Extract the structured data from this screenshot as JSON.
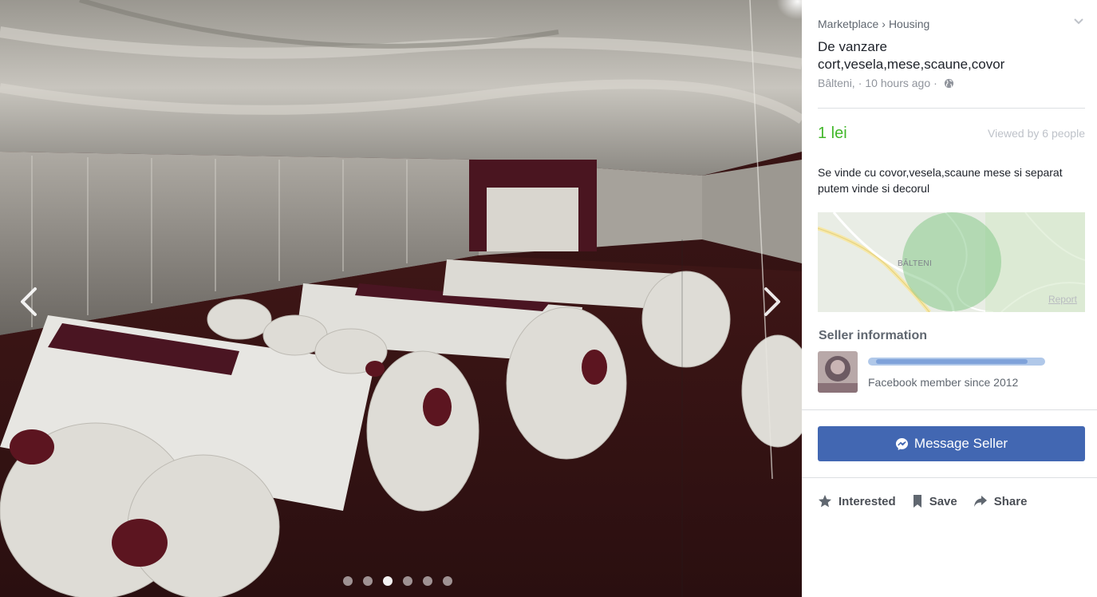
{
  "photo": {
    "prev_icon": "chevron-left-icon",
    "next_icon": "chevron-right-icon",
    "dots": [
      {
        "active": false
      },
      {
        "active": false
      },
      {
        "active": true
      },
      {
        "active": false
      },
      {
        "active": false
      },
      {
        "active": false
      }
    ]
  },
  "listing": {
    "breadcrumb": [
      "Marketplace",
      "Housing"
    ],
    "breadcrumb_separator": "›",
    "title": "De vanzare cort,vesela,mese,scaune,covor",
    "location": "Bâlteni,",
    "meta_separator": "·",
    "time": "10 hours ago",
    "visibility_icon": "globe-icon",
    "price": "1 lei",
    "price_color": "#42b72a",
    "viewed": "Viewed by 6 people",
    "description": "Se vinde cu covor,vesela,scaune mese si separat putem vinde si decorul"
  },
  "map": {
    "town_label": "BĂLTENI",
    "report_label": "Report"
  },
  "seller": {
    "heading": "Seller information",
    "member_since": "Facebook member since 2012"
  },
  "buttons": {
    "message": "Message Seller",
    "message_color": "#4267b2",
    "interested": "Interested",
    "save": "Save",
    "share": "Share"
  }
}
